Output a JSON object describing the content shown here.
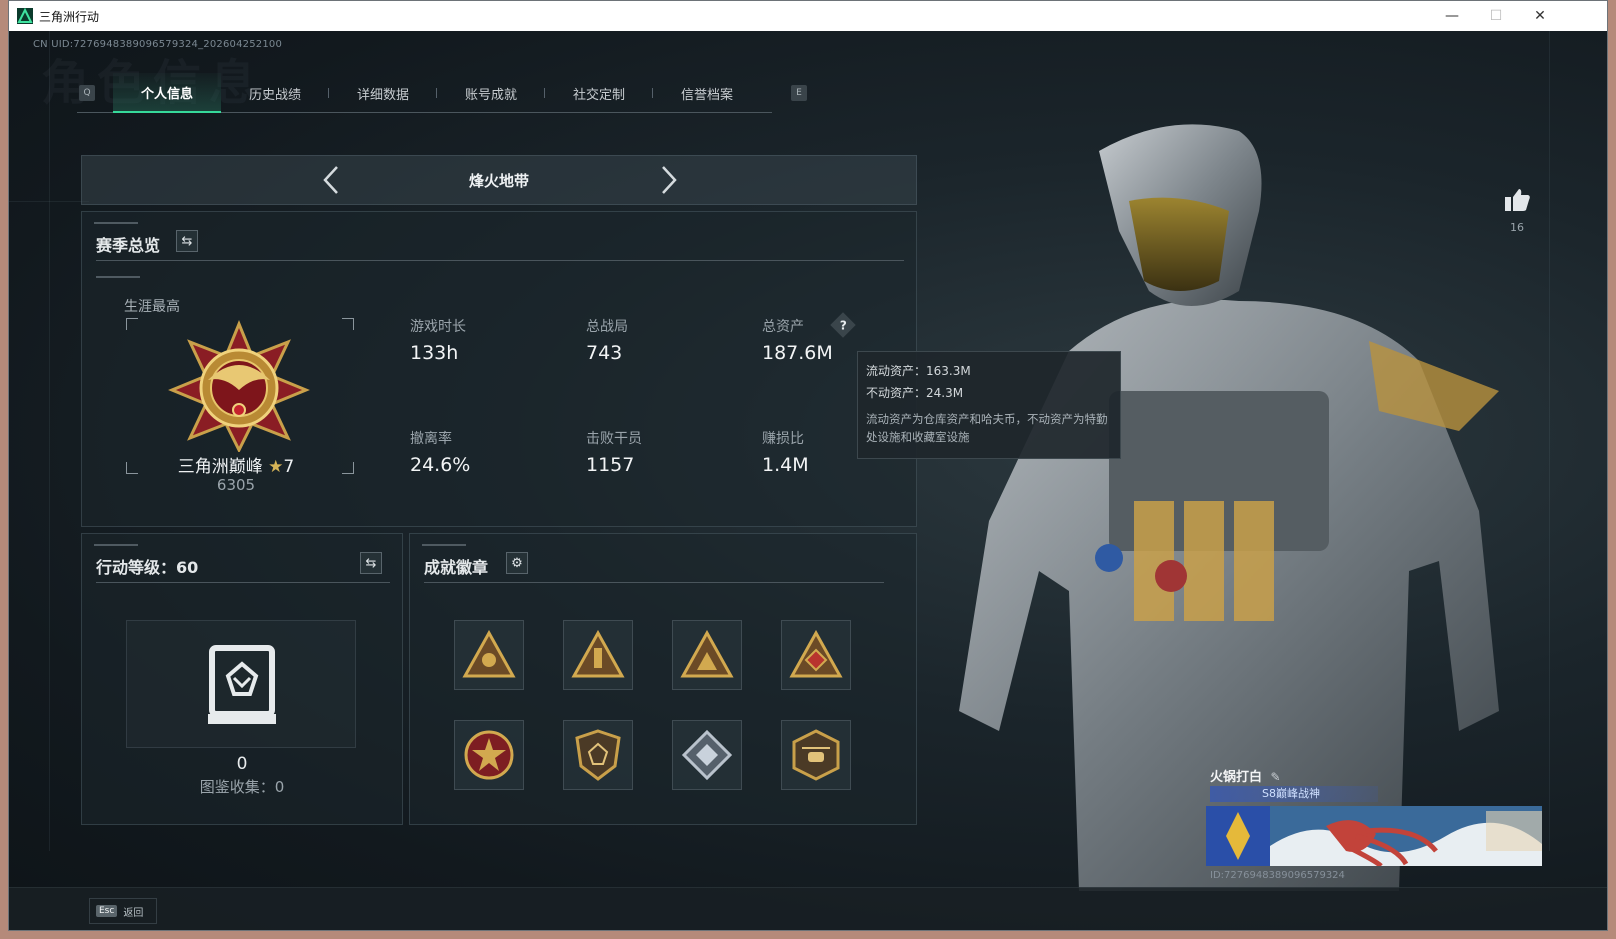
{
  "window": {
    "title": "三角洲行动",
    "controls": {
      "minimize": "—",
      "maximize": "☐",
      "close": "✕"
    }
  },
  "header": {
    "uid_text": "CN UID:7276948389096579324_202604252100",
    "bg_title": "角色信息",
    "key_left": "Q",
    "key_right": "E"
  },
  "tabs": [
    {
      "label": "个人信息",
      "active": true
    },
    {
      "label": "历史战绩",
      "active": false
    },
    {
      "label": "详细数据",
      "active": false
    },
    {
      "label": "账号成就",
      "active": false
    },
    {
      "label": "社交定制",
      "active": false
    },
    {
      "label": "信誉档案",
      "active": false
    }
  ],
  "mode": {
    "name": "烽火地带",
    "prev_icon": "chevron-left-icon",
    "next_icon": "chevron-right-icon"
  },
  "season": {
    "title": "赛季总览",
    "career_label": "生涯最高",
    "rank_name": "三角洲巅峰",
    "rank_stars": "7",
    "rank_points": "6305",
    "stats": [
      {
        "label": "游戏时长",
        "value": "133h"
      },
      {
        "label": "总战局",
        "value": "743"
      },
      {
        "label": "总资产",
        "value": "187.6M"
      },
      {
        "label": "撤离率",
        "value": "24.6%"
      },
      {
        "label": "击败干员",
        "value": "1157"
      },
      {
        "label": "赚损比",
        "value": "1.4M"
      }
    ]
  },
  "tooltip": {
    "liquid": "流动资产：163.3M",
    "fixed": "不动资产：24.3M",
    "desc": "流动资产为仓库资产和哈夫币，不动资产为特勤处设施和收藏室设施"
  },
  "action_level": {
    "title": "行动等级：60",
    "value": "0",
    "collection": "图鉴收集：0"
  },
  "achievements": {
    "title": "成就徽章",
    "badges": [
      "triangle-badge-1",
      "triangle-badge-2",
      "triangle-badge-3",
      "triangle-badge-4",
      "star-medal-badge",
      "shield-badge",
      "diamond-badge",
      "helicopter-badge"
    ]
  },
  "like": {
    "count": "16"
  },
  "namecard": {
    "player_name": "火锅打白",
    "player_title": "S8巅峰战神",
    "player_id": "ID:7276948389096579324"
  },
  "footer": {
    "esc_key": "Esc",
    "back_label": "返回"
  },
  "colors": {
    "accent": "#36d99a",
    "gold": "#c9a04a",
    "bg": "#161d22"
  }
}
